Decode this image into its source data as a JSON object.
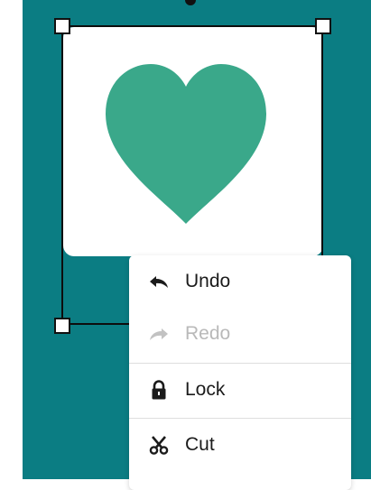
{
  "colors": {
    "canvas_background": "#0b7d83",
    "heart_fill": "#3aa88a",
    "card_background": "#ffffff",
    "disabled_text": "#b9b9b9"
  },
  "shape": {
    "type": "heart-icon"
  },
  "context_menu": {
    "items": [
      {
        "label": "Undo",
        "icon": "undo-icon",
        "enabled": true
      },
      {
        "label": "Redo",
        "icon": "redo-icon",
        "enabled": false
      },
      {
        "label": "Lock",
        "icon": "lock-icon",
        "enabled": true
      },
      {
        "label": "Cut",
        "icon": "scissors-icon",
        "enabled": true
      }
    ]
  }
}
